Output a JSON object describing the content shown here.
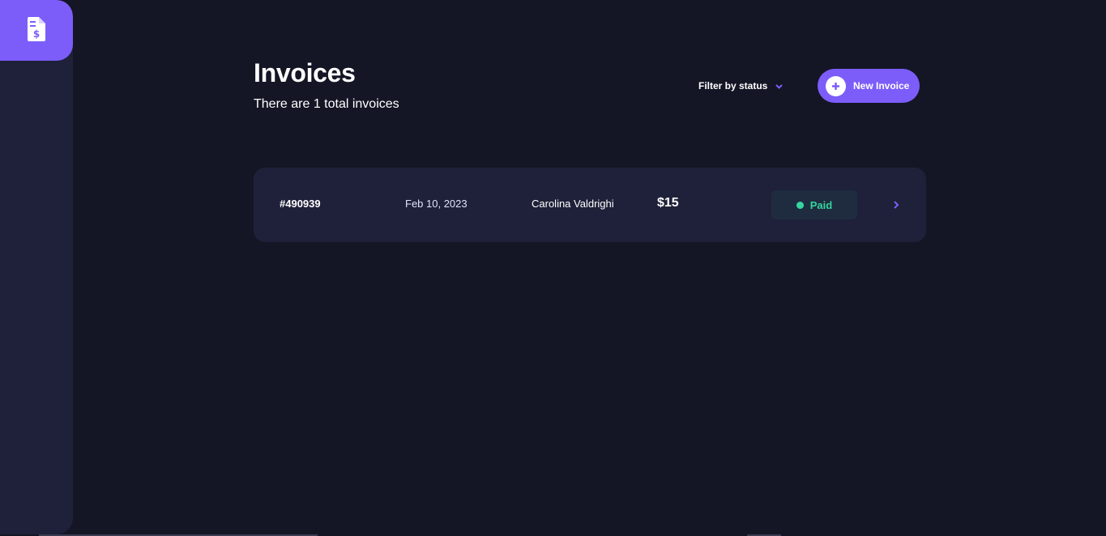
{
  "sidebar": {
    "logo_icon": "invoice-dollar-icon"
  },
  "header": {
    "title": "Invoices",
    "subtitle": "There are 1 total invoices",
    "filter_label": "Filter by status",
    "new_invoice_label": "New Invoice"
  },
  "invoices": [
    {
      "id": "#490939",
      "date": "Feb 10, 2023",
      "client": "Carolina Valdrighi",
      "amount": "$15",
      "status": "Paid"
    }
  ],
  "colors": {
    "accent": "#7c5dfa",
    "background": "#141625",
    "card": "#1e2139",
    "paid": "#33d69f"
  }
}
